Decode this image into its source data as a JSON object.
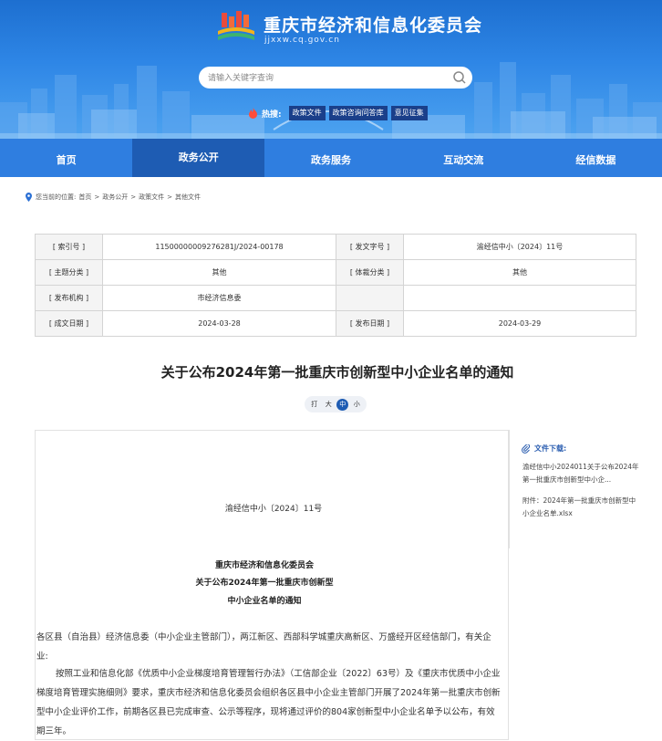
{
  "header": {
    "site_title": "重庆市经济和信息化委员会",
    "site_domain": "jjxxw.cq.gov.cn",
    "search_placeholder": "请输入关键字查询",
    "hot_label": "热搜:",
    "hot_tags": [
      "政策文件",
      "政策咨询问答库",
      "意见征集"
    ]
  },
  "nav": {
    "items": [
      "首页",
      "政务公开",
      "政务服务",
      "互动交流",
      "经信数据"
    ],
    "active_index": 1
  },
  "breadcrumb": {
    "prefix": "您当前的位置:",
    "items": [
      "首页",
      "政务公开",
      "政策文件",
      "其他文件"
    ],
    "separator": ">"
  },
  "info": {
    "index_no_label": "[ 索引号 ]",
    "index_no": "11500000009276281J/2024-00178",
    "doc_no_label": "[ 发文字号 ]",
    "doc_no": "渝经信中小〔2024〕11号",
    "topic_label": "[ 主题分类 ]",
    "topic": "其他",
    "genre_label": "[ 体裁分类 ]",
    "genre": "其他",
    "issuer_label": "[ 发布机构 ]",
    "issuer": "市经济信息委",
    "created_label": "[ 成文日期 ]",
    "created": "2024-03-28",
    "published_label": "[ 发布日期 ]",
    "published": "2024-03-29"
  },
  "article": {
    "title": "关于公布2024年第一批重庆市创新型中小企业名单的通知",
    "font_sizes": [
      "打",
      "大",
      "中",
      "小"
    ],
    "active_font_size": 2,
    "doc_no": "渝经信中小〔2024〕11号",
    "org_line1": "重庆市经济和信息化委员会",
    "org_line2": "关于公布2024年第一批重庆市创新型",
    "org_line3": "中小企业名单的通知",
    "paragraph1": "各区县（自治县）经济信息委（中小企业主管部门），两江新区、西部科学城重庆高新区、万盛经开区经信部门，有关企业:",
    "paragraph2": "按照工业和信息化部《优质中小企业梯度培育管理暂行办法》（工信部企业〔2022〕63号）及《重庆市优质中小企业梯度培育管理实施细则》要求，重庆市经济和信息化委员会组织各区县中小企业主管部门开展了2024年第一批重庆市创新型中小企业评价工作，前期各区县已完成审查、公示等程序，现将通过评价的804家创新型中小企业名单予以公布，有效期三年。"
  },
  "sidebar": {
    "download_heading": "文件下载:",
    "files": [
      "渝经信中小2024011关于公布2024年第一批重庆市创新型中小企...",
      "附件：2024年第一批重庆市创新型中小企业名单.xlsx"
    ]
  },
  "colors": {
    "header_blue": "#2e86e6",
    "nav_blue": "#2f7ee0",
    "nav_active": "#1e5cb3",
    "hot_tag": "#1a3f8a",
    "link_blue": "#2a5db0"
  }
}
